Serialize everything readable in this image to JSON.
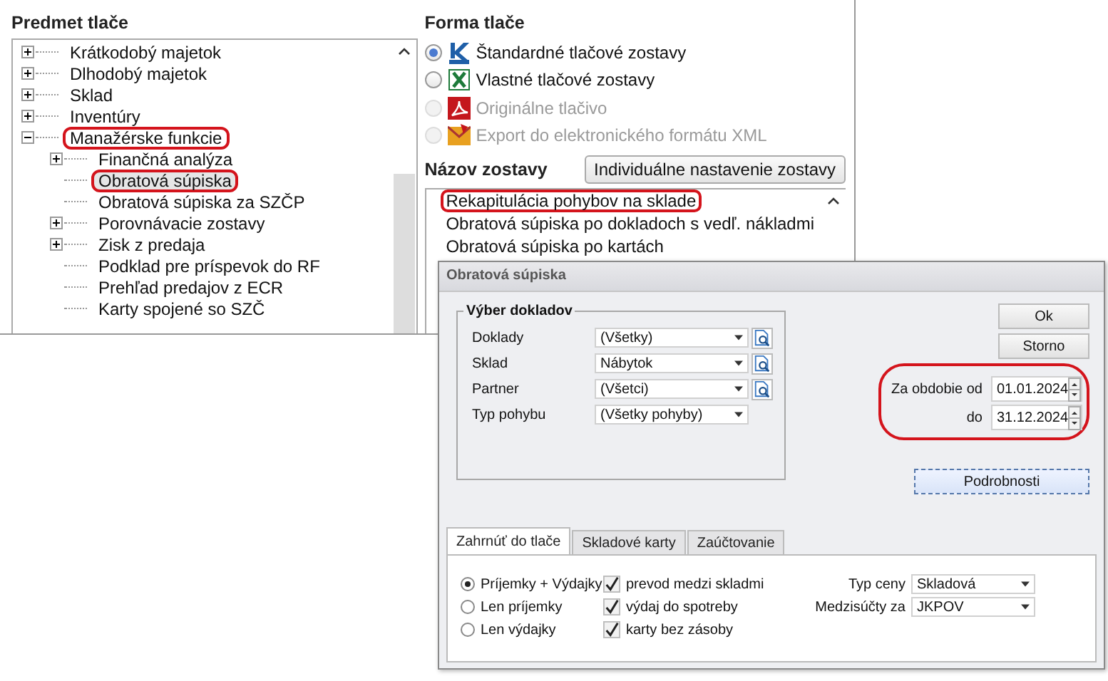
{
  "left_panel": {
    "title": "Predmet tlače",
    "tree": [
      {
        "label": "Krátkodobý majetok",
        "kind": "collapsed",
        "selected": false,
        "highlighted": false
      },
      {
        "label": "Dlhodobý majetok",
        "kind": "collapsed",
        "selected": false,
        "highlighted": false
      },
      {
        "label": "Sklad",
        "kind": "collapsed",
        "selected": false,
        "highlighted": false
      },
      {
        "label": "Inventúry",
        "kind": "collapsed",
        "selected": false,
        "highlighted": false
      },
      {
        "label": "Manažérske funkcie",
        "kind": "expanded",
        "selected": false,
        "highlighted": true,
        "children": [
          {
            "label": "Finančná analýza",
            "kind": "collapsed",
            "selected": false,
            "highlighted": false
          },
          {
            "label": "Obratová súpiska",
            "kind": "leaf",
            "selected": true,
            "highlighted": true
          },
          {
            "label": "Obratová súpiska za SZČP",
            "kind": "leaf",
            "selected": false,
            "highlighted": false
          },
          {
            "label": "Porovnávacie zostavy",
            "kind": "collapsed",
            "selected": false,
            "highlighted": false
          },
          {
            "label": "Zisk z predaja",
            "kind": "collapsed",
            "selected": false,
            "highlighted": false
          },
          {
            "label": "Podklad pre príspevok do RF",
            "kind": "leaf",
            "selected": false,
            "highlighted": false
          },
          {
            "label": "Prehľad predajov z ECR",
            "kind": "leaf",
            "selected": false,
            "highlighted": false
          },
          {
            "label": "Karty spojené so SZČ",
            "kind": "leaf",
            "selected": false,
            "highlighted": false
          }
        ]
      }
    ]
  },
  "right_panel": {
    "print_form": {
      "title": "Forma tlače",
      "options": [
        {
          "label": "Štandardné tlačové zostavy",
          "kind": "kros",
          "selected": true,
          "disabled": false
        },
        {
          "label": "Vlastné tlačové zostavy",
          "kind": "excel",
          "selected": false,
          "disabled": false
        },
        {
          "label": "Originálne tlačivo",
          "kind": "pdf",
          "selected": false,
          "disabled": true
        },
        {
          "label": "Export do elektronického formátu XML",
          "kind": "xml",
          "selected": false,
          "disabled": true
        }
      ]
    },
    "report_name": {
      "title": "Názov zostavy",
      "button": "Individuálne nastavenie zostavy",
      "items": [
        {
          "label": "Rekapitulácia pohybov na sklade",
          "highlighted": true
        },
        {
          "label": "Obratová súpiska po dokladoch s vedľ. nákladmi",
          "highlighted": false
        },
        {
          "label": "Obratová súpiska po kartách",
          "highlighted": false
        }
      ]
    }
  },
  "dialog": {
    "title": "Obratová súpiska",
    "group": {
      "title": "Výber dokladov",
      "fields": [
        {
          "label": "Doklady",
          "value": "(Všetky)",
          "lookup": true
        },
        {
          "label": "Sklad",
          "value": "Nábytok",
          "lookup": true
        },
        {
          "label": "Partner",
          "value": "(Všetci)",
          "lookup": true
        },
        {
          "label": "Typ pohybu",
          "value": "(Všetky pohyby)",
          "lookup": false
        }
      ]
    },
    "buttons": [
      {
        "label": "Ok",
        "focused": false
      },
      {
        "label": "Storno",
        "focused": false
      }
    ],
    "period": {
      "highlighted": true,
      "rows": [
        {
          "label": "Za obdobie od",
          "value": "01.01.2024"
        },
        {
          "label": "do",
          "value": "31.12.2024"
        }
      ]
    },
    "details_button": {
      "label": "Podrobnosti",
      "focused": true
    },
    "tabs": [
      {
        "label": "Zahrnúť do tlače",
        "selected": true
      },
      {
        "label": "Skladové karty",
        "selected": false
      },
      {
        "label": "Zaúčtovanie",
        "selected": false
      }
    ],
    "movement_options": [
      {
        "label": "Príjemky + Výdajky",
        "selected": true
      },
      {
        "label": "Len príjemky",
        "selected": false
      },
      {
        "label": "Len výdajky",
        "selected": false
      }
    ],
    "checkboxes": [
      {
        "label": "prevod medzi skladmi",
        "checked": true
      },
      {
        "label": "výdaj do spotreby",
        "checked": true
      },
      {
        "label": "karty bez zásoby",
        "checked": true
      }
    ],
    "price_fields": [
      {
        "label": "Typ ceny",
        "value": "Skladová"
      },
      {
        "label": "Medzisúčty za",
        "value": "JKPOV"
      }
    ]
  }
}
